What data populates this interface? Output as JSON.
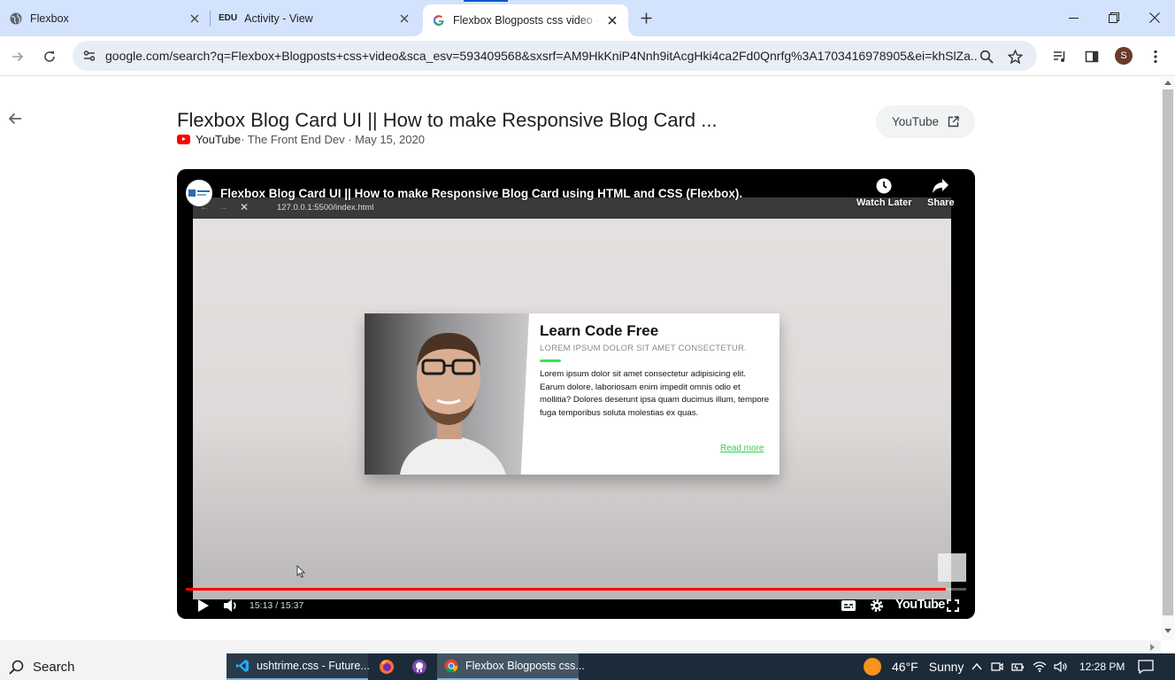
{
  "browser": {
    "tabs": [
      {
        "title": "Flexbox",
        "favicon": "globe-icon"
      },
      {
        "title": "Activity - View",
        "favicon": "edu-icon",
        "favicon_text": "EDU"
      },
      {
        "title": "Flexbox Blogposts css video - G",
        "favicon": "google-icon",
        "active": true
      }
    ],
    "url": "google.com/search?q=Flexbox+Blogposts+css+video&sca_esv=593409568&sxsrf=AM9HkKniP4Nnh9itAcgHki4ca2Fd0Qnrfg%3A1703416978905&ei=khSlZa...",
    "profile_initial": "S"
  },
  "result": {
    "title": "Flexbox Blog Card UI || How to make Responsive Blog Card ...",
    "source": "YouTube",
    "meta": " · The Front End Dev · May 15, 2020",
    "open_button": "YouTube"
  },
  "player": {
    "title": "Flexbox Blog Card UI || How to make Responsive Blog Card using HTML and CSS (Flexbox).",
    "watch_later": "Watch Later",
    "share": "Share",
    "inner_url": "127.0.0.1:5500/index.html",
    "time": "15:13 / 15:37",
    "progress": 0.974,
    "wordmark": "YouTube"
  },
  "blog_card": {
    "heading": "Learn Code Free",
    "subheading": "LOREM IPSUM DOLOR SIT AMET CONSECTETUR.",
    "body": "Lorem ipsum dolor sit amet consectetur adipisicing elit. Earum dolore, laboriosam enim impedit omnis odio et mollitia? Dolores deserunt ipsa quam ducimus illum, tempore fuga temporibus soluta molestias ex quas.",
    "read_more": "Read more",
    "accent_color": "#39e35d"
  },
  "taskbar": {
    "search": "Search",
    "apps": [
      {
        "label": "ushtrime.css - Future...",
        "icon": "vscode-icon"
      },
      {
        "label": "Flexbox Blogposts css...",
        "icon": "chrome-icon"
      }
    ],
    "weather": {
      "temp": "46°F",
      "condition": "Sunny"
    },
    "time": "12:28 PM"
  }
}
